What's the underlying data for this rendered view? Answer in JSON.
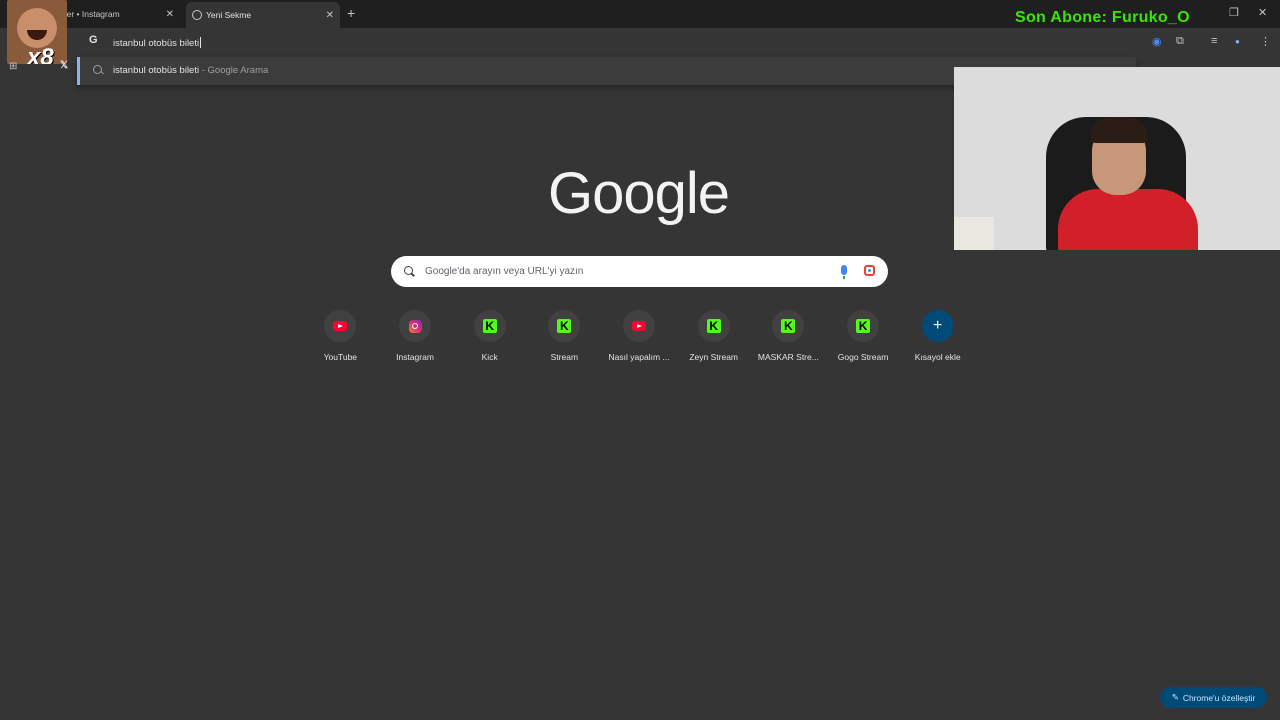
{
  "tabs": [
    {
      "title": "eler • Instagram"
    },
    {
      "title": "Yeni Sekme"
    }
  ],
  "stream_overlay": {
    "last_subscriber": "Son Abone: Furuko_O",
    "emote_badge": "x8"
  },
  "omnibox": {
    "value": "istanbul otobüs bileti",
    "provider_icon": "G"
  },
  "suggestion": {
    "query": "istanbul otobüs bileti",
    "suffix": " - Google Arama"
  },
  "ntp": {
    "logo": "Google",
    "search_placeholder": "Google'da arayın veya URL'yi yazın",
    "shortcuts": [
      {
        "label": "YouTube",
        "icon": "youtube-icon"
      },
      {
        "label": "Instagram",
        "icon": "instagram-icon"
      },
      {
        "label": "Kick",
        "icon": "kick-icon"
      },
      {
        "label": "Stream",
        "icon": "kick-icon"
      },
      {
        "label": "Nasıl yapalım ...",
        "icon": "youtube-icon"
      },
      {
        "label": "Zeyn Stream",
        "icon": "kick-icon"
      },
      {
        "label": "MASKAR Stre...",
        "icon": "kick-icon"
      },
      {
        "label": "Gogo Stream",
        "icon": "kick-icon"
      },
      {
        "label": "Kısayol ekle",
        "icon": "plus-icon"
      }
    ],
    "customize_label": "Chrome'u özelleştir"
  },
  "colors": {
    "background": "#353535",
    "accent": "#8ab4f8",
    "kick_green": "#53fc18",
    "overlay_green": "#39e600"
  }
}
